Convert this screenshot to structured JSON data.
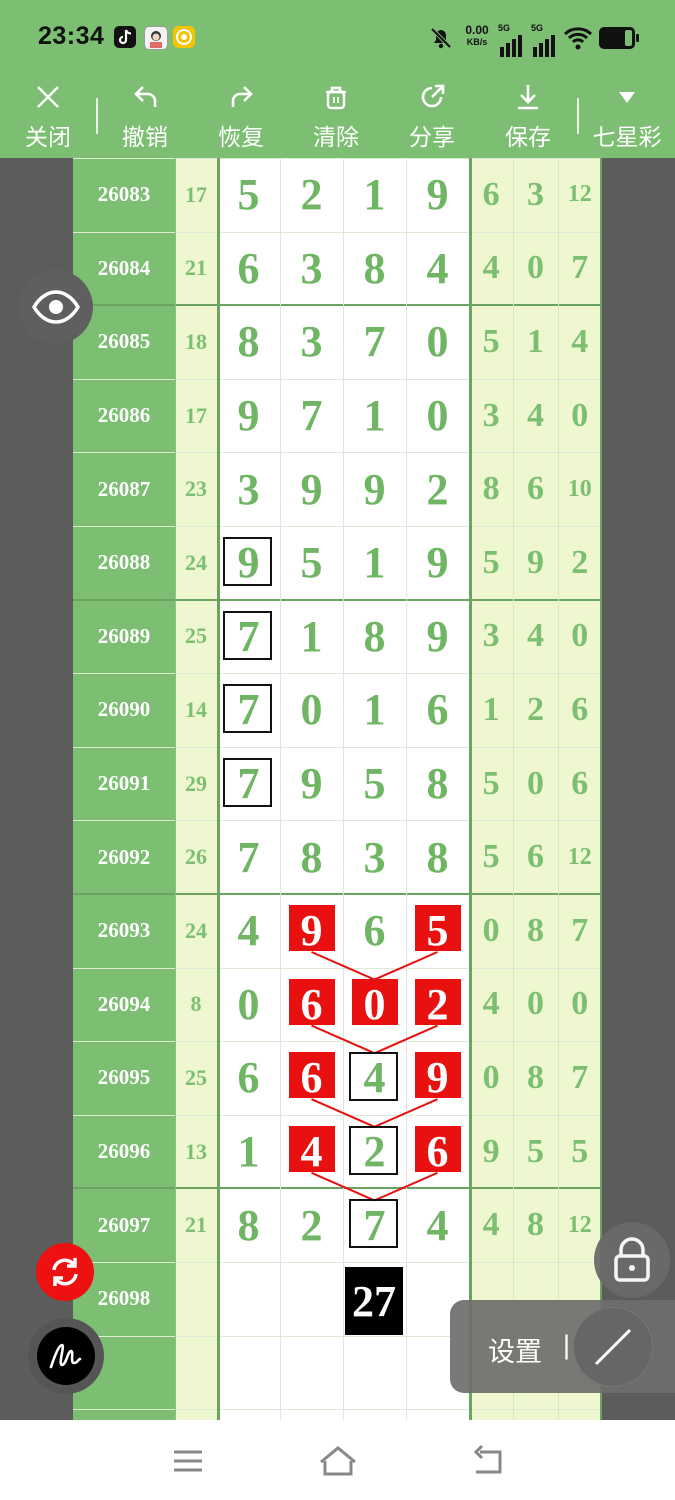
{
  "status_bar": {
    "time": "23:34",
    "net_speed_value": "0.00",
    "net_speed_unit": "KB/s",
    "signal1": "5G",
    "signal2": "5G"
  },
  "toolbar": {
    "close_label": "关闭",
    "undo_label": "撤销",
    "redo_label": "恢复",
    "clear_label": "清除",
    "share_label": "分享",
    "save_label": "保存",
    "lottery_label": "七星彩"
  },
  "table": {
    "rows": [
      {
        "issue": "26083",
        "sum": "17",
        "digits": [
          "5",
          "2",
          "1",
          "9"
        ],
        "tail": [
          "6",
          "3",
          "12"
        ]
      },
      {
        "issue": "26084",
        "sum": "21",
        "digits": [
          "6",
          "3",
          "8",
          "4"
        ],
        "tail": [
          "4",
          "0",
          "7"
        ]
      },
      {
        "issue": "26085",
        "sum": "18",
        "digits": [
          "8",
          "3",
          "7",
          "0"
        ],
        "tail": [
          "5",
          "1",
          "4"
        ]
      },
      {
        "issue": "26086",
        "sum": "17",
        "digits": [
          "9",
          "7",
          "1",
          "0"
        ],
        "tail": [
          "3",
          "4",
          "0"
        ]
      },
      {
        "issue": "26087",
        "sum": "23",
        "digits": [
          "3",
          "9",
          "9",
          "2"
        ],
        "tail": [
          "8",
          "6",
          "10"
        ]
      },
      {
        "issue": "26088",
        "sum": "24",
        "digits": [
          "9",
          "5",
          "1",
          "9"
        ],
        "tail": [
          "5",
          "9",
          "2"
        ]
      },
      {
        "issue": "26089",
        "sum": "25",
        "digits": [
          "7",
          "1",
          "8",
          "9"
        ],
        "tail": [
          "3",
          "4",
          "0"
        ]
      },
      {
        "issue": "26090",
        "sum": "14",
        "digits": [
          "7",
          "0",
          "1",
          "6"
        ],
        "tail": [
          "1",
          "2",
          "6"
        ]
      },
      {
        "issue": "26091",
        "sum": "29",
        "digits": [
          "7",
          "9",
          "5",
          "8"
        ],
        "tail": [
          "5",
          "0",
          "6"
        ]
      },
      {
        "issue": "26092",
        "sum": "26",
        "digits": [
          "7",
          "8",
          "3",
          "8"
        ],
        "tail": [
          "5",
          "6",
          "12"
        ]
      },
      {
        "issue": "26093",
        "sum": "24",
        "digits": [
          "4",
          "9",
          "6",
          "5"
        ],
        "tail": [
          "0",
          "8",
          "7"
        ]
      },
      {
        "issue": "26094",
        "sum": "8",
        "digits": [
          "0",
          "6",
          "0",
          "2"
        ],
        "tail": [
          "4",
          "0",
          "0"
        ]
      },
      {
        "issue": "26095",
        "sum": "25",
        "digits": [
          "6",
          "6",
          "4",
          "9"
        ],
        "tail": [
          "0",
          "8",
          "7"
        ]
      },
      {
        "issue": "26096",
        "sum": "13",
        "digits": [
          "1",
          "4",
          "2",
          "6"
        ],
        "tail": [
          "9",
          "5",
          "5"
        ]
      },
      {
        "issue": "26097",
        "sum": "21",
        "digits": [
          "8",
          "2",
          "7",
          "4"
        ],
        "tail": [
          "4",
          "8",
          "12"
        ]
      },
      {
        "issue": "26098",
        "sum": "",
        "digits": [
          "",
          "",
          "",
          ""
        ],
        "tail": [
          "",
          "",
          ""
        ]
      },
      {
        "issue": "",
        "sum": "",
        "digits": [
          "",
          "",
          "",
          ""
        ],
        "tail": [
          "",
          "",
          ""
        ]
      }
    ],
    "prediction": "27"
  },
  "overlay": {
    "settings_label": "设置",
    "settings_separator": "|"
  },
  "colors": {
    "brand_green": "#7cbf72",
    "digit_green": "#6fb564",
    "tail_bg": "#eef7cf",
    "highlight_red": "#e8110f"
  }
}
